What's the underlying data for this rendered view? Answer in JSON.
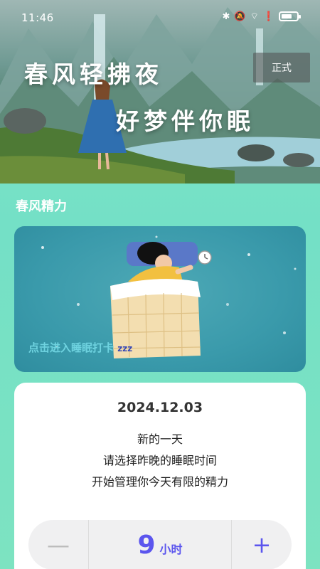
{
  "status_bar": {
    "time": "11:46",
    "icons": [
      "bluetooth-icon",
      "mute-icon",
      "wifi-icon",
      "alert-icon",
      "battery-icon"
    ]
  },
  "hero": {
    "title_line1": "春风轻拂夜",
    "title_line2": "好梦伴你眠",
    "env_badge": "正式"
  },
  "section": {
    "title": "春风精力"
  },
  "sleep_card": {
    "cta": "点击进入睡眠打卡",
    "zzz": "zzz"
  },
  "date_card": {
    "date": "2024.12.03",
    "line1": "新的一天",
    "line2": "请选择昨晚的睡眠时间",
    "line3": "开始管理你今天有限的精力"
  },
  "stepper": {
    "minus": "—",
    "value": "9",
    "unit": "小时",
    "plus": "+"
  },
  "colors": {
    "accent": "#5b55ee",
    "background": "#7ee6c8",
    "cta_text": "#6fd3e0"
  }
}
